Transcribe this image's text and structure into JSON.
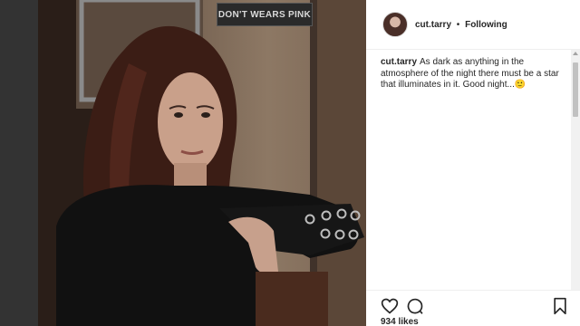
{
  "photo": {
    "sign_text": "DON'T WEARS PINK"
  },
  "post": {
    "username": "cut.tarry",
    "separator": "•",
    "follow_status": "Following",
    "caption_username": "cut.tarry",
    "caption_text": "As dark as anything in the atmosphere of the night there must be a star that illuminates in it. Good night...🙂",
    "likes": "934 likes"
  },
  "icons": {
    "like": "heart-icon",
    "comment": "comment-icon",
    "save": "bookmark-icon"
  }
}
